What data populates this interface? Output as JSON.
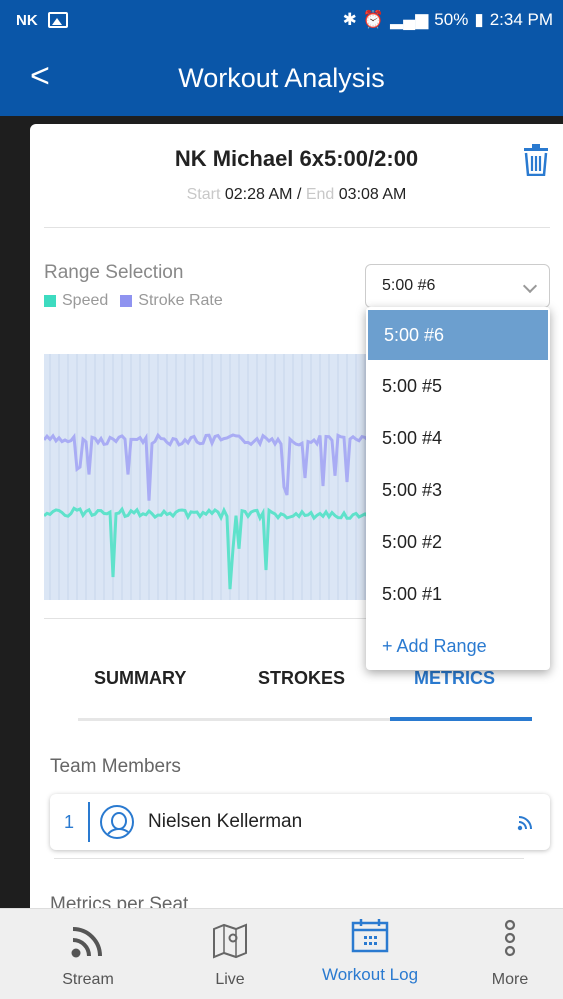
{
  "status_bar": {
    "carrier": "NK",
    "battery": "50%",
    "time": "2:34 PM"
  },
  "app_bar": {
    "title": "Workout Analysis"
  },
  "workout": {
    "title": "NK Michael 6x5:00/2:00",
    "start_label": "Start",
    "start_time": "02:28 AM",
    "separator": "/",
    "end_label": "End",
    "end_time": "03:08 AM"
  },
  "range": {
    "label": "Range Selection",
    "selected": "5:00 #6",
    "legend": [
      {
        "name": "Speed",
        "color": "#3ddbc0"
      },
      {
        "name": "Stroke Rate",
        "color": "#8f93f0"
      }
    ],
    "options": [
      "5:00 #6",
      "5:00 #5",
      "5:00 #4",
      "5:00 #3",
      "5:00 #2",
      "5:00 #1"
    ],
    "add_label": "+ Add Range"
  },
  "tabs": [
    {
      "label": "SUMMARY",
      "active": false
    },
    {
      "label": "STROKES",
      "active": false
    },
    {
      "label": "METRICS",
      "active": true
    }
  ],
  "team": {
    "title": "Team Members",
    "members": [
      {
        "seat": "1",
        "name": "Nielsen Kellerman"
      }
    ]
  },
  "metrics_title": "Metrics per Seat",
  "bottom_nav": [
    {
      "label": "Stream",
      "icon": "stream-icon",
      "active": false
    },
    {
      "label": "Live",
      "icon": "map-icon",
      "active": false
    },
    {
      "label": "Workout Log",
      "icon": "calendar-icon",
      "active": true
    },
    {
      "label": "More",
      "icon": "more-icon",
      "active": false
    }
  ],
  "colors": {
    "primary": "#0a56a8",
    "accent": "#2a7ad0",
    "speed": "#3ddbc0",
    "stroke_rate": "#8f93f0",
    "chart_bg": "#dbe6f5"
  }
}
